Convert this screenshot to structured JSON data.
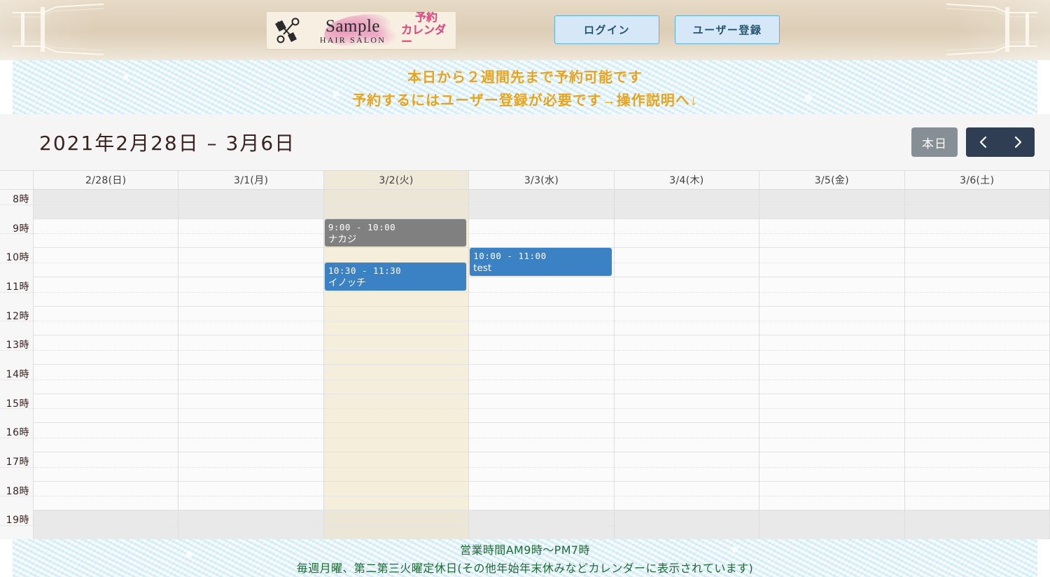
{
  "header": {
    "logo": {
      "icon": "scissors-comb-icon",
      "brand": "Sample",
      "brand_sub": "HAIR SALON",
      "jp_line1": "予約",
      "jp_line2": "カレンダー"
    },
    "buttons": [
      {
        "name": "login-button",
        "label": "ログイン"
      },
      {
        "name": "user-register-button",
        "label": "ユーザー登録"
      }
    ],
    "button_bg": "#d6e8f7",
    "button_border": "#5bb3e0",
    "button_text_color": "#23546e"
  },
  "notice": {
    "line1": "本日から２週間先まで予約可能です",
    "line2": "予約するにはユーザー登録が必要です→操作説明へ↓",
    "color": "#e8a31c",
    "background": "#e4f4fb"
  },
  "toolbar": {
    "range_title": "2021年2月28日 – 3月6日",
    "today_label": "本日",
    "prev_icon": "chevron-left-icon",
    "next_icon": "chevron-right-icon",
    "today_bg": "#868e96",
    "nav_bg": "#2f3e52"
  },
  "calendar": {
    "today_column_index": 2,
    "today_highlight": "#f5eedb",
    "days": [
      {
        "label": "2/28(日)"
      },
      {
        "label": "3/1(月)"
      },
      {
        "label": "3/2(火)"
      },
      {
        "label": "3/3(水)"
      },
      {
        "label": "3/4(木)"
      },
      {
        "label": "3/5(金)"
      },
      {
        "label": "3/6(土)"
      }
    ],
    "hours": [
      {
        "label": "8時",
        "disabled": true
      },
      {
        "label": "9時",
        "disabled": false
      },
      {
        "label": "10時",
        "disabled": false
      },
      {
        "label": "11時",
        "disabled": false
      },
      {
        "label": "12時",
        "disabled": false
      },
      {
        "label": "13時",
        "disabled": false
      },
      {
        "label": "14時",
        "disabled": false
      },
      {
        "label": "15時",
        "disabled": false
      },
      {
        "label": "16時",
        "disabled": false
      },
      {
        "label": "17時",
        "disabled": false
      },
      {
        "label": "18時",
        "disabled": false
      },
      {
        "label": "19時",
        "disabled": true
      }
    ],
    "events": [
      {
        "day_index": 2,
        "time": "9:00 - 10:00",
        "title": "ナカジ",
        "start_hour": 9.0,
        "end_hour": 10.0,
        "color": "#808080"
      },
      {
        "day_index": 2,
        "time": "10:30 - 11:30",
        "title": "イノッチ",
        "start_hour": 10.5,
        "end_hour": 11.5,
        "color": "#3b82c4"
      },
      {
        "day_index": 3,
        "time": "10:00 - 11:00",
        "title": "test",
        "start_hour": 10.0,
        "end_hour": 11.0,
        "color": "#3b82c4"
      }
    ]
  },
  "footer": {
    "line1": "営業時間AM9時〜PM7時",
    "line2": "毎週月曜、第二第三火曜定休日(その他年始年末休みなどカレンダーに表示されています)",
    "color": "#1d6b33"
  }
}
